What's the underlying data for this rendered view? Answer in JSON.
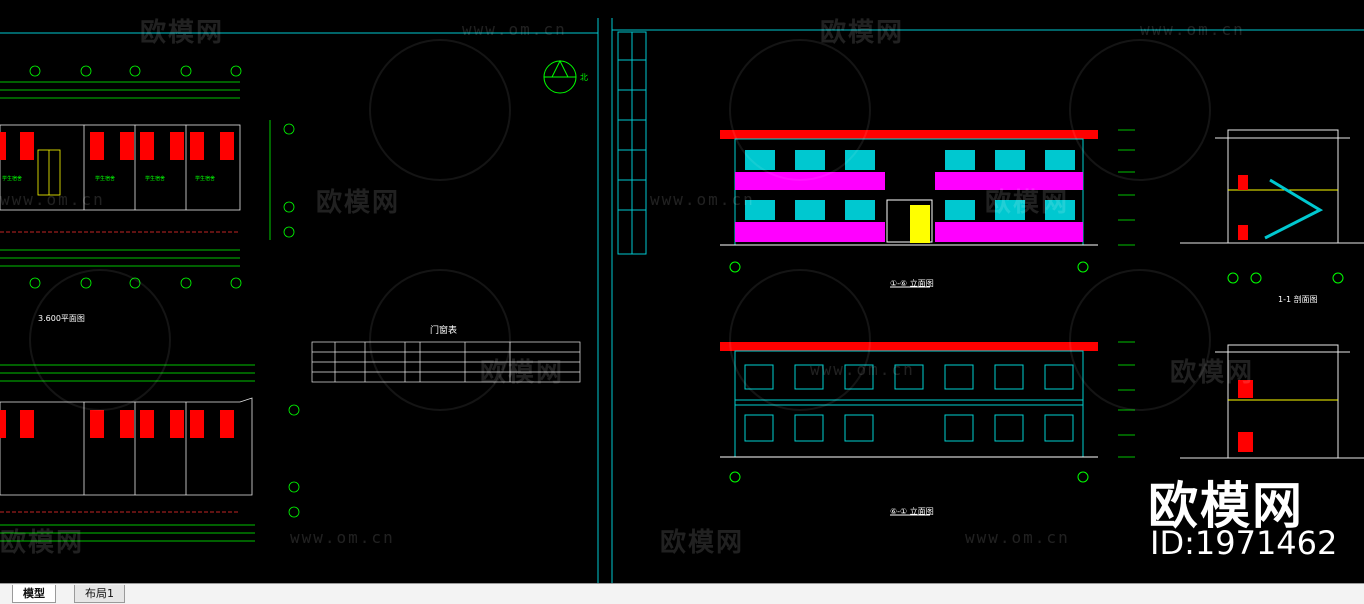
{
  "canvas": {
    "background": "#000000",
    "line_color": "#00d0d0",
    "wall_color": "#ff0000",
    "railing_color": "#ff00ff",
    "grid_color": "#00ff00"
  },
  "watermark": {
    "brand": "欧模网",
    "url": "www.om.cn"
  },
  "overlay": {
    "brand": "欧模网",
    "id": "ID:1971462"
  },
  "drawings": {
    "plan_upper_title": "3.600平面图",
    "door_table_title": "门窗表",
    "elevation_front_title": "①-⑥ 立面图",
    "elevation_rear_title": "⑥-① 立面图",
    "section_title": "1-1 剖面图",
    "north_label": "北"
  },
  "tabs": {
    "model": "模型",
    "layout": "布局1"
  }
}
